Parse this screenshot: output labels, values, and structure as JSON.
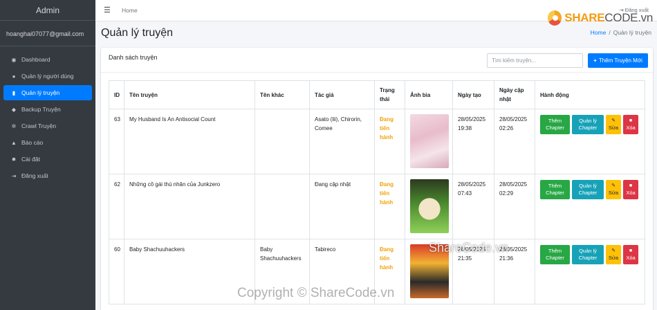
{
  "sidebar": {
    "brand": "Admin",
    "user_email": "hoanghai07077@gmail.com",
    "items": [
      {
        "label": "Dashboard",
        "icon": "dashboard-icon",
        "glyph": "◉",
        "active": false
      },
      {
        "label": "Quản lý người dùng",
        "icon": "users-icon",
        "glyph": "👥",
        "active": false
      },
      {
        "label": "Quản lý truyện",
        "icon": "book-icon",
        "glyph": "▮",
        "active": true
      },
      {
        "label": "Backup Truyện",
        "icon": "tags-icon",
        "glyph": "◆",
        "active": false
      },
      {
        "label": "Crawl Truyện",
        "icon": "spider-icon",
        "glyph": "✲",
        "active": false
      },
      {
        "label": "Báo cáo",
        "icon": "warning-icon",
        "glyph": "▲",
        "active": false
      },
      {
        "label": "Cài đặt",
        "icon": "gear-icon",
        "glyph": "✹",
        "active": false
      },
      {
        "label": "Đăng xuất",
        "icon": "logout-icon",
        "glyph": "⇥",
        "active": false
      }
    ]
  },
  "topbar": {
    "home_link": "Home",
    "logout_label": "Đăng xuất"
  },
  "header": {
    "title": "Quản lý truyện",
    "breadcrumb_home": "Home",
    "breadcrumb_current": "Quản lý truyện"
  },
  "card": {
    "title": "Danh sách truyện",
    "search_placeholder": "Tìm kiếm truyện...",
    "add_button": "Thêm Truyện Mới"
  },
  "table": {
    "columns": [
      "ID",
      "Tên truyện",
      "Tên khác",
      "Tác giả",
      "Trạng thái",
      "Ảnh bìa",
      "Ngày tạo",
      "Ngày cập nhật",
      "Hành động"
    ],
    "rows": [
      {
        "id": "63",
        "name": "My Husband Is An Antisocial Count",
        "other": "",
        "author": "Asato (lii), Chirorin, Comee",
        "status": "Đang tiến hành",
        "created": "28/05/2025 19:38",
        "updated": "28/05/2025 02:26"
      },
      {
        "id": "62",
        "name": "Những cô gái thú nhân của Junkzero",
        "other": "",
        "author": "Đang cập nhật",
        "status": "Đang tiến hành",
        "created": "28/05/2025 07:43",
        "updated": "28/05/2025 02:29"
      },
      {
        "id": "60",
        "name": "Baby Shachuuhackers",
        "other": "Baby Shachuuhackers",
        "author": "Tabireco",
        "status": "Đang tiến hành",
        "created": "28/05/2025 21:35",
        "updated": "28/05/2025 21:36"
      }
    ],
    "actions": {
      "add_chapter": "Thêm Chapter",
      "manage_chapter": "Quản lý Chapter",
      "edit": "Sửa",
      "delete": "Xóa"
    }
  },
  "logo": {
    "share": "SHARE",
    "code": "CODE.vn"
  },
  "watermarks": {
    "center": "ShareCode.vn",
    "bottom": "Copyright © ShareCode.vn"
  },
  "colors": {
    "primary": "#007bff",
    "success": "#28a745",
    "info": "#17a2b8",
    "warning": "#ffc107",
    "danger": "#dc3545",
    "status": "#f0a30a",
    "sidebar": "#343a40"
  }
}
